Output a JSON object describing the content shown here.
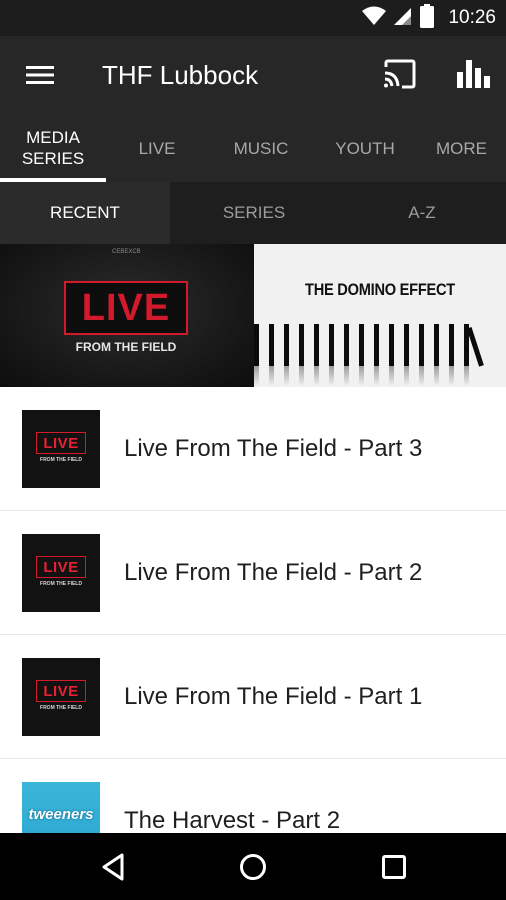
{
  "status_bar": {
    "time": "10:26",
    "icons": [
      "wifi-icon",
      "cellular-signal-icon",
      "battery-icon"
    ]
  },
  "app_bar": {
    "title": "THF Lubbock",
    "actions": [
      "cast-icon",
      "bar-chart-icon"
    ],
    "menu_icon": "hamburger-menu-icon"
  },
  "main_tabs": [
    {
      "label": "MEDIA\nSERIES",
      "active": true
    },
    {
      "label": "LIVE",
      "active": false
    },
    {
      "label": "MUSIC",
      "active": false
    },
    {
      "label": "YOUTH",
      "active": false
    },
    {
      "label": "MORE",
      "active": false
    }
  ],
  "sub_tabs": [
    {
      "label": "RECENT",
      "active": true
    },
    {
      "label": "SERIES",
      "active": false
    },
    {
      "label": "A-Z",
      "active": false
    }
  ],
  "banners": {
    "left": {
      "live_text": "LIVE",
      "subtitle": "FROM THE FIELD",
      "small_text": "CEBEXCB"
    },
    "right": {
      "title": "THE DOMINO EFFECT"
    }
  },
  "list_items": [
    {
      "title": "Live From The Field - Part 3",
      "thumb": "live"
    },
    {
      "title": "Live From The Field - Part 2",
      "thumb": "live"
    },
    {
      "title": "Live From The Field - Part 1",
      "thumb": "live"
    },
    {
      "title": "The Harvest - Part 2",
      "thumb": "tweeners"
    }
  ],
  "thumb_text": {
    "live": "LIVE",
    "live_sub": "FROM THE FIELD",
    "tweeners": "tweeners"
  },
  "nav_bar": [
    "back-icon",
    "home-icon",
    "recents-icon"
  ],
  "colors": {
    "status_bar": "#1d1d1d",
    "app_bar": "#272727",
    "sub_tabs": "#1e1e1e",
    "accent_red": "#d21a2a",
    "harvest_blue": "#2aa4cf"
  }
}
